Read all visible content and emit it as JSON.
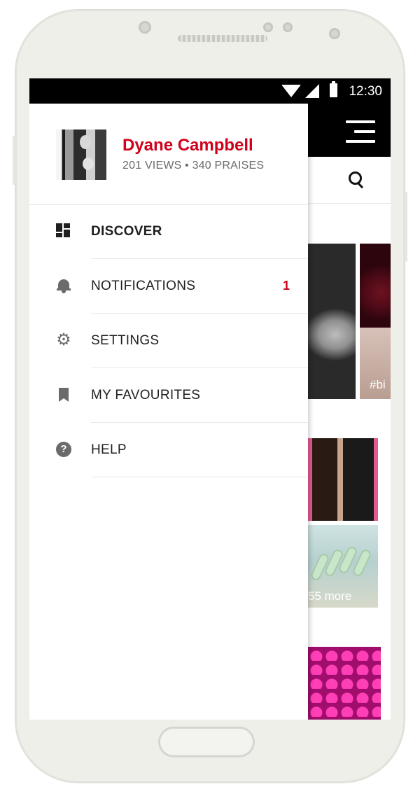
{
  "status_bar": {
    "time": "12:30"
  },
  "profile": {
    "name": "Dyane Campbell",
    "stats": "201 VIEWS • 340 PRAISES"
  },
  "menu": {
    "items": [
      {
        "label": "DISCOVER",
        "icon": "dashboard-icon"
      },
      {
        "label": "NOTIFICATIONS",
        "icon": "bell-icon",
        "badge": "1"
      },
      {
        "label": "SETTINGS",
        "icon": "gear-icon"
      },
      {
        "label": "MY FAVOURITES",
        "icon": "bookmark-icon"
      },
      {
        "label": "HELP",
        "icon": "help-icon"
      }
    ]
  },
  "background": {
    "tile_tag": "#bi",
    "tile_more": "55 more"
  },
  "colors": {
    "accent": "#d0021b",
    "toolbar": "#000000"
  }
}
